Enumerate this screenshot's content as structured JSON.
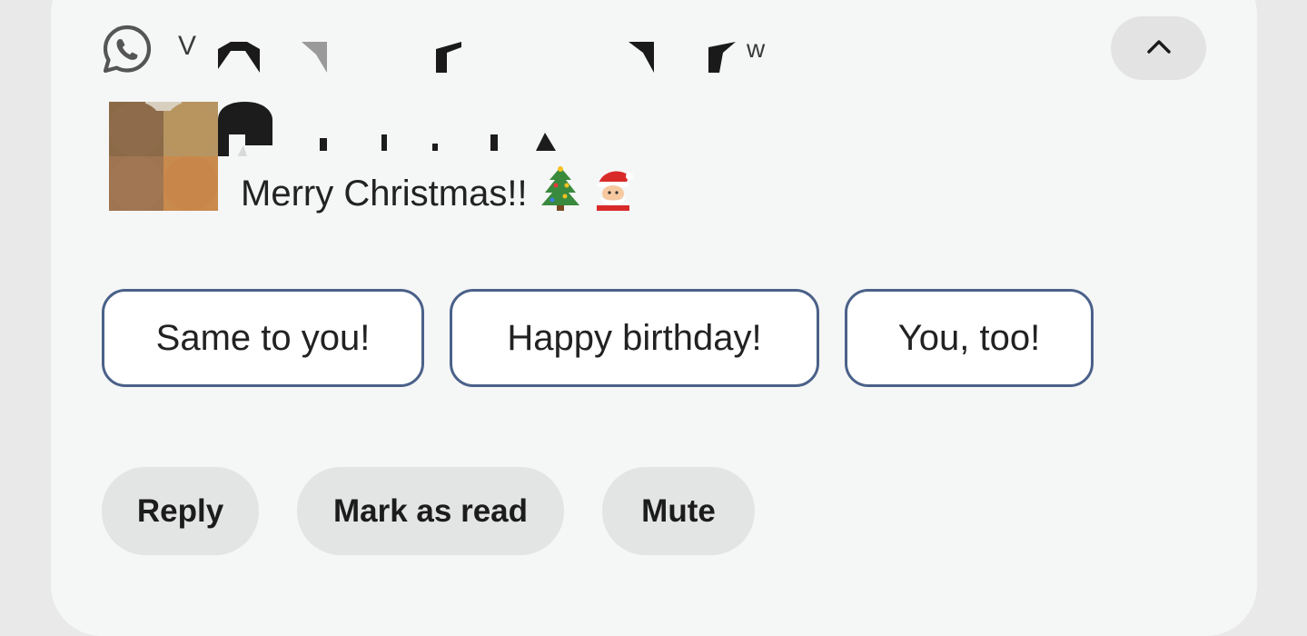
{
  "notification": {
    "app_icon": "whatsapp-icon",
    "app_name_visible": "V",
    "app_name_tail": "w",
    "collapse_icon": "chevron-up-icon",
    "avatar": "avatar-image-redacted",
    "message": {
      "text": "Merry Christmas!!",
      "emoji": [
        "christmas-tree-emoji",
        "santa-emoji"
      ]
    }
  },
  "smart_replies": [
    {
      "label": "Same to you!"
    },
    {
      "label": "Happy birthday!"
    },
    {
      "label": "You, too!"
    }
  ],
  "actions": [
    {
      "label": "Reply"
    },
    {
      "label": "Mark as read"
    },
    {
      "label": "Mute"
    }
  ],
  "colors": {
    "card_bg": "#f5f6f6",
    "page_bg": "#e9e9e9",
    "chip_border": "#4a6189",
    "action_bg": "#e3e4e4",
    "whatsapp_icon": "#555555"
  }
}
